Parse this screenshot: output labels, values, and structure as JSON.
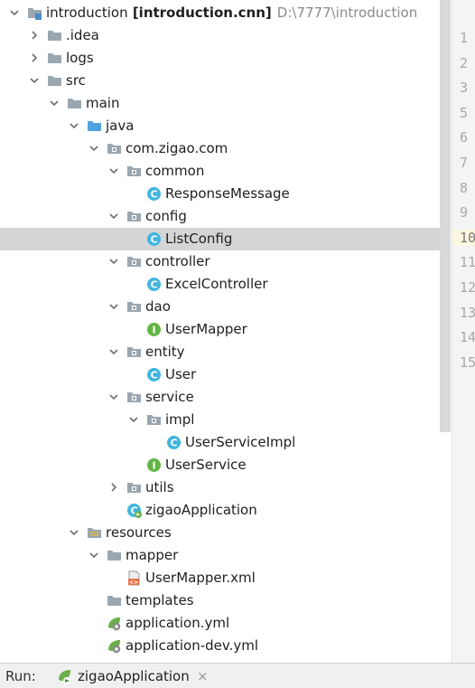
{
  "project_tree": {
    "items": [
      {
        "label": "introduction",
        "suffix": "[introduction.cnn]",
        "path": "D:\\7777\\introduction",
        "icon": "module-folder-icon",
        "expanded": true,
        "depth": 0
      },
      {
        "label": ".idea",
        "icon": "folder-icon",
        "expanded": false,
        "depth": 1
      },
      {
        "label": "logs",
        "icon": "folder-icon",
        "expanded": false,
        "depth": 1
      },
      {
        "label": "src",
        "icon": "folder-icon",
        "expanded": true,
        "depth": 1
      },
      {
        "label": "main",
        "icon": "folder-icon",
        "expanded": true,
        "depth": 2
      },
      {
        "label": "java",
        "icon": "source-folder-icon",
        "expanded": true,
        "depth": 3
      },
      {
        "label": "com.zigao.com",
        "icon": "package-icon",
        "expanded": true,
        "depth": 4
      },
      {
        "label": "common",
        "icon": "package-icon",
        "expanded": true,
        "depth": 5
      },
      {
        "label": "ResponseMessage",
        "icon": "class-icon",
        "depth": 6
      },
      {
        "label": "config",
        "icon": "package-icon",
        "expanded": true,
        "depth": 5
      },
      {
        "label": "ListConfig",
        "icon": "class-icon",
        "depth": 6,
        "selected": true
      },
      {
        "label": "controller",
        "icon": "package-icon",
        "expanded": true,
        "depth": 5
      },
      {
        "label": "ExcelController",
        "icon": "class-icon",
        "depth": 6
      },
      {
        "label": "dao",
        "icon": "package-icon",
        "expanded": true,
        "depth": 5
      },
      {
        "label": "UserMapper",
        "icon": "interface-icon",
        "depth": 6
      },
      {
        "label": "entity",
        "icon": "package-icon",
        "expanded": true,
        "depth": 5
      },
      {
        "label": "User",
        "icon": "class-icon",
        "depth": 6
      },
      {
        "label": "service",
        "icon": "package-icon",
        "expanded": true,
        "depth": 5
      },
      {
        "label": "impl",
        "icon": "package-icon",
        "expanded": true,
        "depth": 6
      },
      {
        "label": "UserServiceImpl",
        "icon": "class-icon",
        "depth": 7
      },
      {
        "label": "UserService",
        "icon": "interface-icon",
        "depth": 6
      },
      {
        "label": "utils",
        "icon": "package-icon",
        "expanded": false,
        "depth": 5
      },
      {
        "label": "zigaoApplication",
        "icon": "spring-boot-class-icon",
        "depth": 5
      },
      {
        "label": "resources",
        "icon": "resources-folder-icon",
        "expanded": true,
        "depth": 3
      },
      {
        "label": "mapper",
        "icon": "folder-icon",
        "expanded": true,
        "depth": 4
      },
      {
        "label": "UserMapper.xml",
        "icon": "xml-file-icon",
        "depth": 5
      },
      {
        "label": "templates",
        "icon": "folder-icon",
        "depth": 4
      },
      {
        "label": "application.yml",
        "icon": "spring-config-icon",
        "depth": 4
      },
      {
        "label": "application-dev.yml",
        "icon": "spring-config-icon",
        "depth": 4
      }
    ]
  },
  "line_numbers": [
    "1",
    "2",
    "3",
    "5",
    "6",
    "7",
    "8",
    "9",
    "10",
    "11",
    "12",
    "13",
    "14",
    "15"
  ],
  "current_line": "10",
  "run_bar": {
    "label": "Run:",
    "tab_label": "zigaoApplication",
    "close_glyph": "×"
  },
  "colors": {
    "selection": "#d5d5d5",
    "folder": "#9aa7b0",
    "source_folder": "#4fa3e0",
    "class_badge": "#40b6e0",
    "interface_badge": "#62b543",
    "spring": "#6ab04c",
    "xml": "#e8734a"
  }
}
